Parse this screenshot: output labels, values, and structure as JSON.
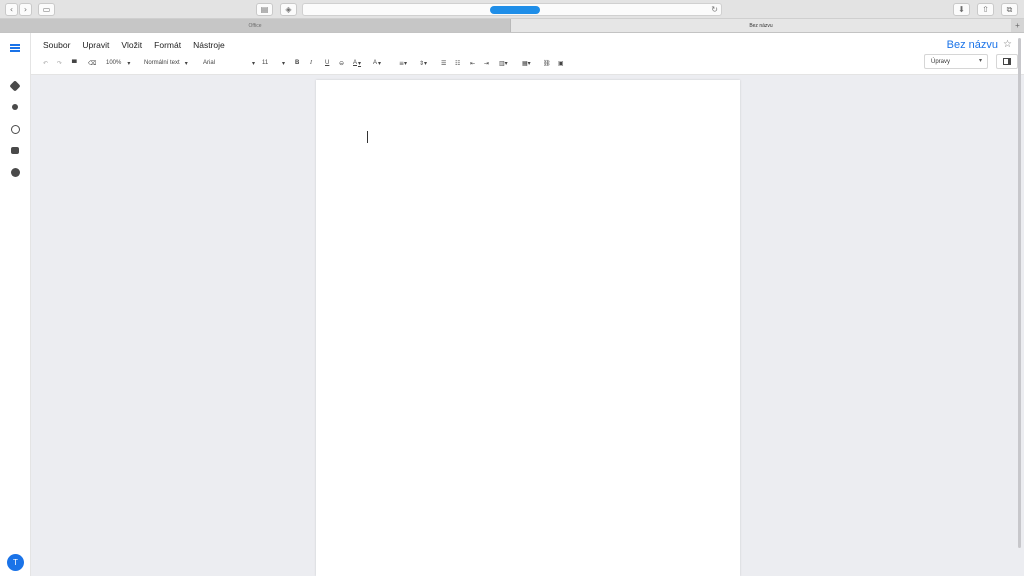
{
  "browser": {
    "tabs": [
      {
        "label": "Office"
      },
      {
        "label": "Bez názvu"
      }
    ],
    "new_tab": "+"
  },
  "app": {
    "menu": [
      "Soubor",
      "Upravit",
      "Vložit",
      "Formát",
      "Nástroje"
    ],
    "doc_title": "Bez názvu",
    "toolbar": {
      "zoom": "100%",
      "style": "Normální text",
      "font": "Arial",
      "font_size": "11",
      "bold": "B",
      "italic": "I",
      "underline": "U",
      "text_color": "A",
      "highlight": "A"
    },
    "mode": "Úpravy",
    "user_initial": "T",
    "accent": "#1a73e8"
  }
}
